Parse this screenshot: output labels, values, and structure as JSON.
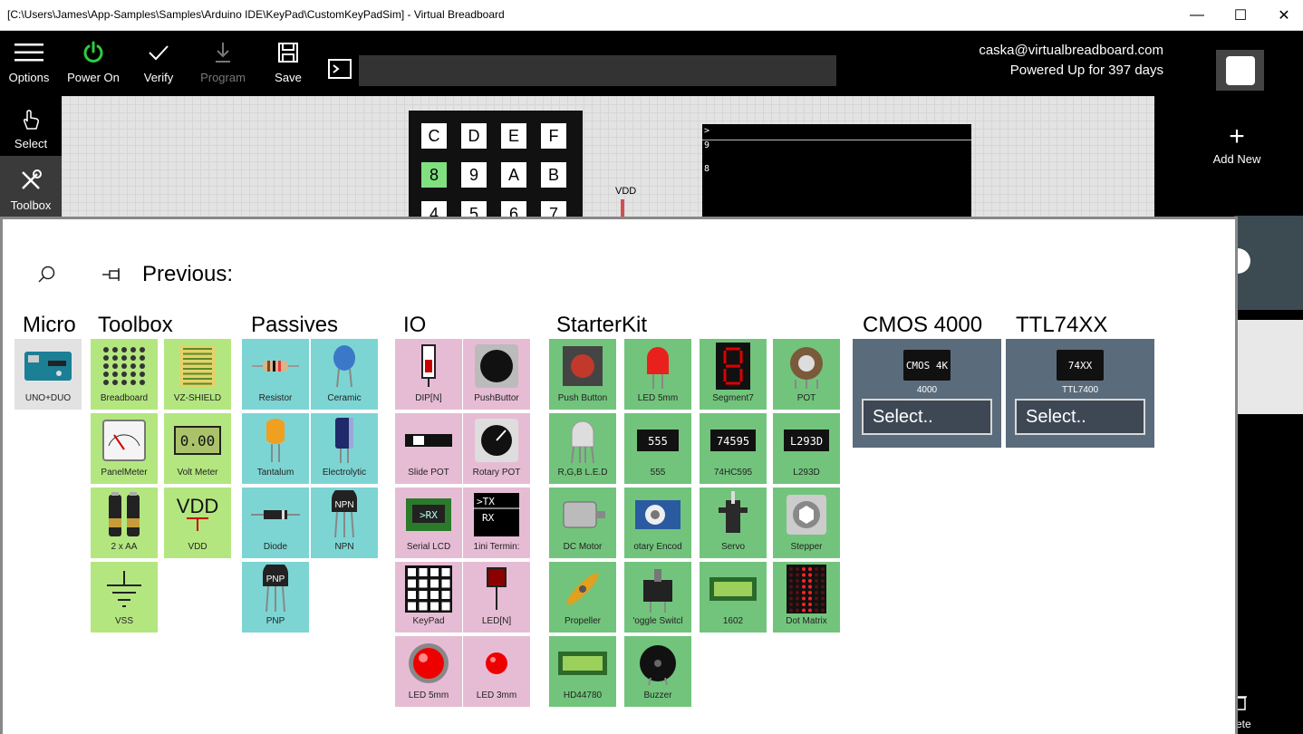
{
  "window": {
    "title": "[C:\\Users\\James\\App-Samples\\Samples\\Arduino IDE\\KeyPad\\CustomKeyPadSim] - Virtual Breadboard",
    "minimize": "—",
    "maximize": "☐",
    "close": "✕"
  },
  "toolbar": {
    "options": "Options",
    "power_on": "Power On",
    "verify": "Verify",
    "program": "Program",
    "save": "Save",
    "command_value": "",
    "user_email": "caska@virtualbreadboard.com",
    "user_uptime": "Powered Up for 397 days",
    "power_color": "#2ecc40"
  },
  "rail": {
    "select": "Select",
    "toolbox": "Toolbox"
  },
  "canvas": {
    "keypad_keys": [
      "C",
      "D",
      "E",
      "F",
      "8",
      "9",
      "A",
      "B",
      "4",
      "5",
      "6",
      "7"
    ],
    "highlighted_key": "8",
    "vdd_label": "VDD",
    "terminal_lines": [
      ">",
      "9",
      "8"
    ]
  },
  "right_rail": {
    "add_new": "Add New",
    "delete_partial": "ete"
  },
  "toolbox": {
    "previous_label": "Previous:",
    "categories": {
      "micro": "Micro",
      "toolbox": "Toolbox",
      "passives": "Passives",
      "io": "IO",
      "starterkit": "StarterKit",
      "cmos": "CMOS 4000",
      "ttl": "TTL74XX"
    },
    "micro_items": [
      "UNO+DUO"
    ],
    "toolbox_items": [
      "Breadboard",
      "VZ-SHIELD",
      "PanelMeter",
      "Volt Meter",
      "2 x AA",
      "VDD",
      "VSS"
    ],
    "passives_items": [
      "Resistor",
      "Ceramic",
      "Tantalum",
      "Electrolytic",
      "Diode",
      "NPN",
      "PNP"
    ],
    "io_items": [
      "DIP[N]",
      "PushButtor",
      "Slide POT",
      "Rotary POT",
      "Serial LCD",
      "1ini Termin:",
      "KeyPad",
      "LED[N]",
      "LED 5mm",
      "LED 3mm"
    ],
    "starterkit_items": [
      "Push Button",
      "LED 5mm",
      "Segment7",
      "POT",
      "R,G,B L.E.D",
      "555",
      "74HC595",
      "L293D",
      "DC Motor",
      "otary Encod",
      "Servo",
      "Stepper",
      "Propeller",
      "'oggle Switcl",
      "1602",
      "Dot Matrix",
      "HD44780",
      "Buzzer"
    ],
    "chip_text": {
      "voltmeter": "0.00",
      "vdd": "VDD",
      "npn": "NPN",
      "pnp": "PNP",
      "serial_lcd": ">RX",
      "term_tx": ">TX",
      "term_rx": "RX",
      "ic555": "555",
      "ic595": "74595",
      "ic293": "L293D"
    },
    "cmos": {
      "chip": "CMOS 4K",
      "label": "4000",
      "select": "Select.."
    },
    "ttl": {
      "chip": "74XX",
      "label": "TTL7400",
      "select": "Select.."
    }
  }
}
